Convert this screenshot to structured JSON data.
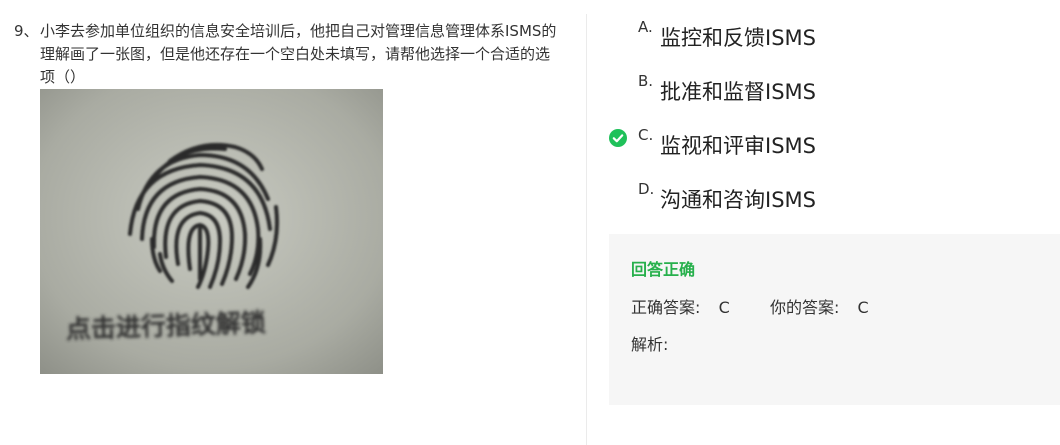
{
  "question": {
    "number": "9、",
    "text": "小李去参加单位组织的信息安全培训后，他把自己对管理信息管理体系ISMS的理解画了一张图，但是他还存在一个空白处未填写，请帮他选择一个合适的选项（）",
    "image_caption": "点击进行指纹解锁"
  },
  "options": [
    {
      "letter": "A.",
      "text": "监控和反馈ISMS",
      "selected": false
    },
    {
      "letter": "B.",
      "text": "批准和监督ISMS",
      "selected": false
    },
    {
      "letter": "C.",
      "text": "监视和评审ISMS",
      "selected": true
    },
    {
      "letter": "D.",
      "text": "沟通和咨询ISMS",
      "selected": false
    }
  ],
  "result": {
    "status": "回答正确",
    "correct_label": "正确答案:",
    "correct_value": "C",
    "your_label": "你的答案:",
    "your_value": "C",
    "analysis_label": "解析:"
  },
  "colors": {
    "correct_green": "#27b04c",
    "check_green": "#1fc15a",
    "panel_bg": "#f6f6f6"
  }
}
